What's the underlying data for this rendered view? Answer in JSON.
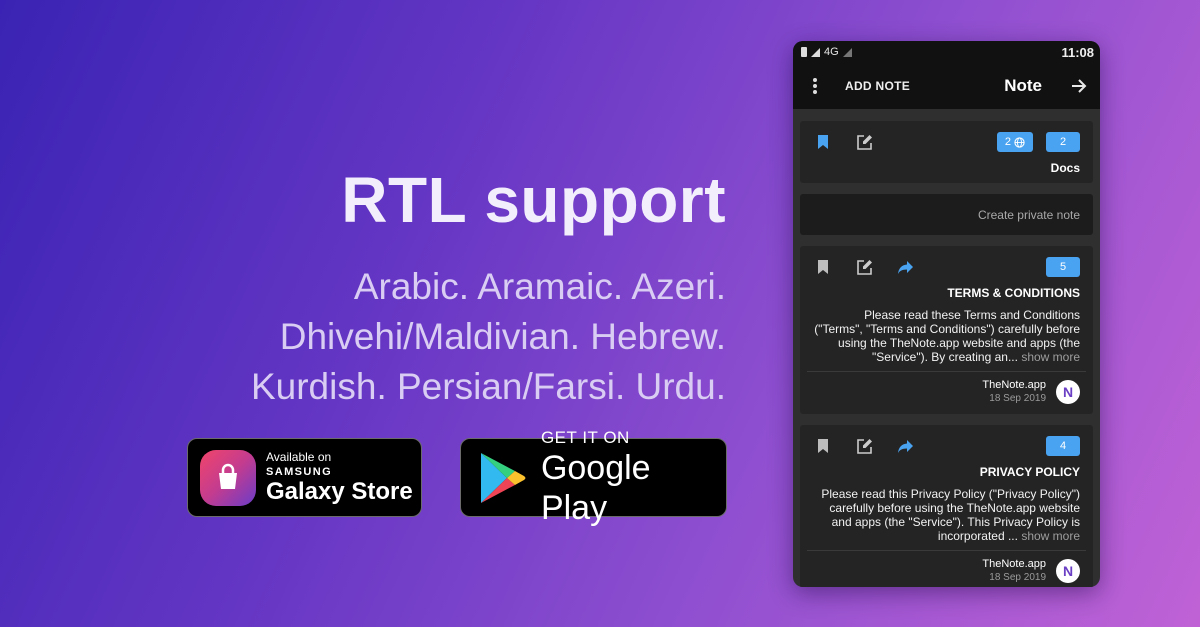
{
  "hero": {
    "title": "RTL support",
    "languages": [
      "Arabic. Aramaic. Azeri.",
      "Dhivehi/Maldivian. Hebrew.",
      "Kurdish. Persian/Farsi. Urdu."
    ]
  },
  "badges": {
    "samsung": {
      "line1": "Available on",
      "line2": "SAMSUNG",
      "line3": "Galaxy Store"
    },
    "google": {
      "line1": "GET IT ON",
      "line2": "Google Play"
    }
  },
  "phone": {
    "status": {
      "network": "4G",
      "time": "11:08"
    },
    "app_bar": {
      "add_note": "ADD NOTE",
      "title": "Note"
    },
    "docs_card": {
      "pill_global": "2",
      "pill_count": "2",
      "title": "Docs"
    },
    "private_note": {
      "placeholder": "Create private note"
    },
    "notes": [
      {
        "count": "5",
        "title": "TERMS & CONDITIONS",
        "body": "Please read these Terms and Conditions (\"Terms\", \"Terms and Conditions\") carefully before using the TheNote.app website and apps (the \"Service\"). By creating an...",
        "show_more": "show more",
        "author": "TheNote.app",
        "date": "18 Sep 2019",
        "avatar": "N"
      },
      {
        "count": "4",
        "title": "PRIVACY POLICY",
        "body": "Please read this Privacy Policy (\"Privacy Policy\") carefully before using the TheNote.app website and apps (the \"Service\"). This Privacy Policy is incorporated ...",
        "show_more": "show more",
        "author": "TheNote.app",
        "date": "18 Sep 2019",
        "avatar": "N"
      }
    ]
  },
  "colors": {
    "accent_blue": "#4aa3f0",
    "card_bg": "#242424",
    "app_bar_bg": "#111111"
  },
  "icons": [
    "bookmark-icon",
    "edit-icon",
    "share-icon",
    "globe-icon",
    "menu-dots-icon",
    "arrow-right-icon",
    "shopping-bag-icon",
    "play-triangle-icon"
  ]
}
